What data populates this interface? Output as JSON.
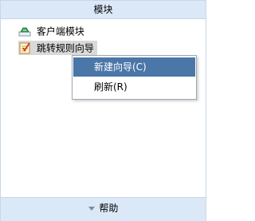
{
  "header": {
    "title": "模块"
  },
  "tree": {
    "items": [
      {
        "label": "客户端模块",
        "icon": "client-module-icon"
      },
      {
        "label": "跳转规则向导",
        "icon": "wizard-checklist-icon",
        "selected": true
      }
    ]
  },
  "context_menu": {
    "items": [
      {
        "label": "新建向导(C)",
        "highlighted": true
      },
      {
        "label": "刷新(R)"
      }
    ]
  },
  "footer": {
    "label": "帮助",
    "icon": "expand-triangle-icon"
  },
  "colors": {
    "header_bg": "#dbe8f7",
    "menu_highlight": "#4a76a8",
    "selected_item_bg": "#d9d9d9"
  }
}
